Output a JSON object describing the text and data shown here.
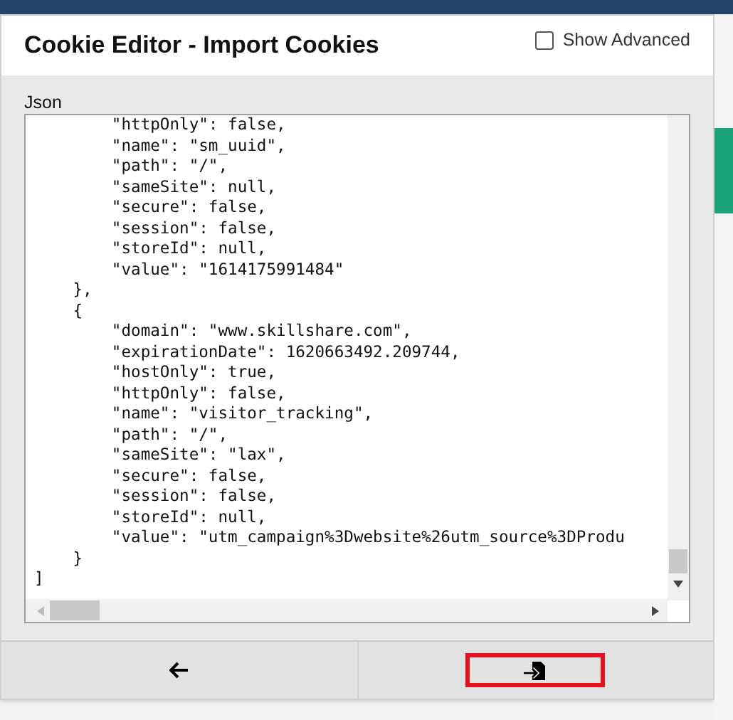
{
  "dialog": {
    "title": "Cookie Editor - Import Cookies",
    "show_advanced": {
      "label": "Show Advanced",
      "checked": false
    }
  },
  "editor": {
    "label": "Json",
    "lines": [
      "        \"httpOnly\": false,",
      "        \"name\": \"sm_uuid\",",
      "        \"path\": \"/\",",
      "        \"sameSite\": null,",
      "        \"secure\": false,",
      "        \"session\": false,",
      "        \"storeId\": null,",
      "        \"value\": \"1614175991484\"",
      "    },",
      "    {",
      "        \"domain\": \"www.skillshare.com\",",
      "        \"expirationDate\": 1620663492.209744,",
      "        \"hostOnly\": true,",
      "        \"httpOnly\": false,",
      "        \"name\": \"visitor_tracking\",",
      "        \"path\": \"/\",",
      "        \"sameSite\": \"lax\",",
      "        \"secure\": false,",
      "        \"session\": false,",
      "        \"storeId\": null,",
      "        \"value\": \"utm_campaign%3Dwebsite%26utm_source%3DProdu",
      "    }",
      "]"
    ]
  },
  "footer": {
    "buttons": [
      {
        "kind": "back",
        "highlighted": false
      },
      {
        "kind": "import",
        "highlighted": true
      }
    ]
  }
}
